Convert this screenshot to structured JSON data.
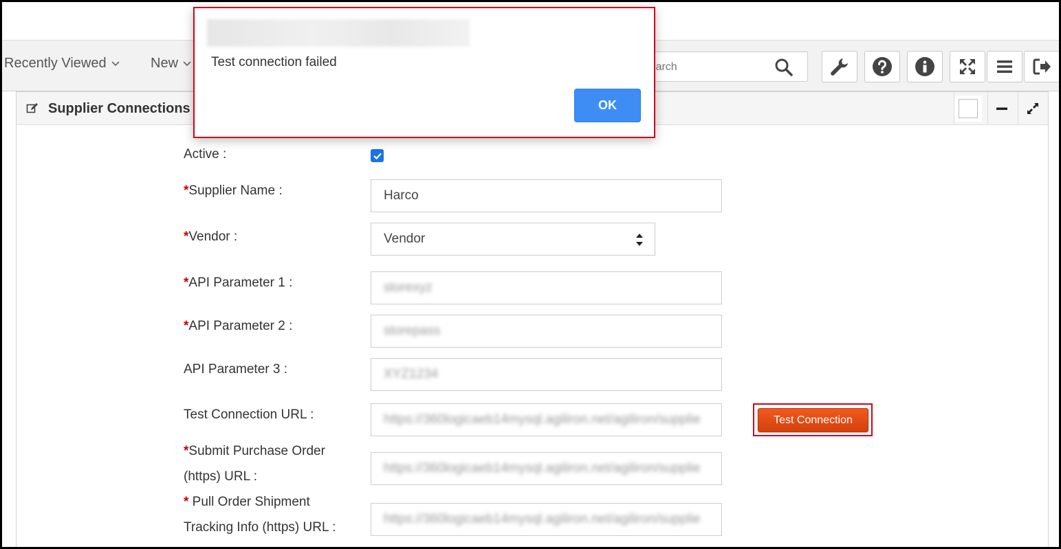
{
  "nav": {
    "recently_viewed": "Recently Viewed",
    "new": "New",
    "search_placeholder": "Search",
    "chevron": "⌄"
  },
  "toolbar": {
    "icons": [
      "wrench-icon",
      "help-icon",
      "info-icon",
      "fullscreen-icon",
      "menu-icon",
      "logout-icon"
    ]
  },
  "panel": {
    "title": "Supplier Connections"
  },
  "form": {
    "active_label": "Active :",
    "active_checked": true,
    "supplier_name_label": "Supplier Name :",
    "supplier_name_value": "Harco",
    "vendor_label": "Vendor :",
    "vendor_value": "Vendor",
    "api1_label": "API Parameter 1 :",
    "api1_value": "storexyz",
    "api2_label": "API Parameter 2 :",
    "api2_value": "storepass",
    "api3_label": "API Parameter 3 :",
    "api3_value": "XYZ1234",
    "test_url_label": "Test Connection URL :",
    "test_url_value": "https://360logicaeb14mysql.agiliron.net/agiliron/supplie",
    "submit_po_label_1": "Submit Purchase Order",
    "submit_po_label_2": "(https) URL :",
    "submit_po_value": "https://360logicaeb14mysql.agiliron.net/agiliron/supplie",
    "pull_label_1": " Pull Order Shipment",
    "pull_label_2": "Tracking Info (https) URL :",
    "pull_value": "https://360logicaeb14mysql.agiliron.net/agiliron/supplie",
    "required_mark": "*",
    "test_connection_button": "Test Connection"
  },
  "dialog": {
    "message": "Test connection failed",
    "ok": "OK"
  },
  "colors": {
    "accent_blue": "#3d8df5",
    "test_button": "#e0481a",
    "highlight_red": "#d0021b",
    "required": "#cc0000"
  }
}
